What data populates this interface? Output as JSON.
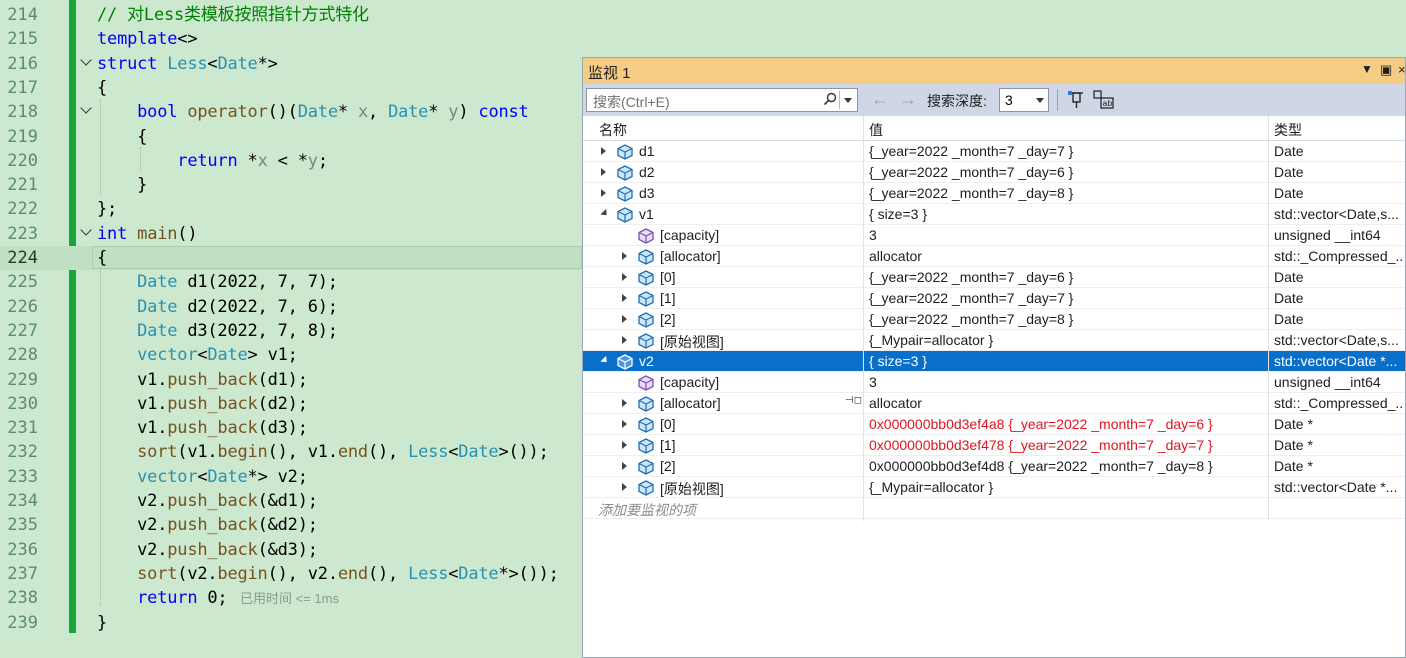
{
  "editor": {
    "lines": [
      {
        "n": "214",
        "html": "<span class=\"cm\">// 对Less类模板按照指针方式特化</span>"
      },
      {
        "n": "215",
        "html": "<span class=\"kw\">template</span>&lt;&gt;"
      },
      {
        "n": "216",
        "html": "<span class=\"kw\">struct</span> <span class=\"ty\">Less</span>&lt;<span class=\"ty\">Date</span>*&gt;"
      },
      {
        "n": "217",
        "html": "{"
      },
      {
        "n": "218",
        "html": "    <span class=\"kw\">bool</span> <span class=\"fn\">operator</span>()(<span class=\"ty\">Date</span>* <span class=\"pm\">x</span>, <span class=\"ty\">Date</span>* <span class=\"pm\">y</span>) <span class=\"kw\">const</span>"
      },
      {
        "n": "219",
        "html": "    {"
      },
      {
        "n": "220",
        "html": "        <span class=\"kw\">return</span> *<span class=\"pm\">x</span> &lt; *<span class=\"pm\">y</span>;"
      },
      {
        "n": "221",
        "html": "    }"
      },
      {
        "n": "222",
        "html": "};"
      },
      {
        "n": "223",
        "html": "<span class=\"kw\">int</span> <span class=\"fn\">main</span>()"
      },
      {
        "n": "224",
        "html": "{"
      },
      {
        "n": "225",
        "html": "    <span class=\"ty\">Date</span> d1(2022, 7, 7);"
      },
      {
        "n": "226",
        "html": "    <span class=\"ty\">Date</span> d2(2022, 7, 6);"
      },
      {
        "n": "227",
        "html": "    <span class=\"ty\">Date</span> d3(2022, 7, 8);"
      },
      {
        "n": "228",
        "html": "    <span class=\"ty\">vector</span>&lt;<span class=\"ty\">Date</span>&gt; v1;"
      },
      {
        "n": "229",
        "html": "    v1.<span class=\"fn\">push_back</span>(d1);"
      },
      {
        "n": "230",
        "html": "    v1.<span class=\"fn\">push_back</span>(d2);"
      },
      {
        "n": "231",
        "html": "    v1.<span class=\"fn\">push_back</span>(d3);"
      },
      {
        "n": "232",
        "html": "    <span class=\"fn\">sort</span>(v1.<span class=\"fn\">begin</span>(), v1.<span class=\"fn\">end</span>(), <span class=\"ty\">Less</span>&lt;<span class=\"ty\">Date</span>&gt;());"
      },
      {
        "n": "233",
        "html": "    <span class=\"ty\">vector</span>&lt;<span class=\"ty\">Date</span>*&gt; v2;"
      },
      {
        "n": "234",
        "html": "    v2.<span class=\"fn\">push_back</span>(&amp;d1);"
      },
      {
        "n": "235",
        "html": "    v2.<span class=\"fn\">push_back</span>(&amp;d2);"
      },
      {
        "n": "236",
        "html": "    v2.<span class=\"fn\">push_back</span>(&amp;d3);"
      },
      {
        "n": "237",
        "html": "    <span class=\"fn\">sort</span>(v2.<span class=\"fn\">begin</span>(), v2.<span class=\"fn\">end</span>(), <span class=\"ty\">Less</span>&lt;<span class=\"ty\">Date</span>*&gt;());"
      },
      {
        "n": "238",
        "html": "    <span class=\"kw\">return</span> 0;"
      },
      {
        "n": "239",
        "html": "}"
      }
    ],
    "current_line": "224",
    "perf_tip": "已用时间 <= 1ms"
  },
  "watch": {
    "title": "监视 1",
    "search_placeholder": "搜索(Ctrl+E)",
    "depth_label": "搜索深度:",
    "depth_value": "3",
    "columns": {
      "name": "名称",
      "value": "值",
      "type": "类型"
    },
    "rows": [
      {
        "name": "d1",
        "value": "{_year=2022 _month=7 _day=7 }",
        "type": "Date"
      },
      {
        "name": "d2",
        "value": "{_year=2022 _month=7 _day=6 }",
        "type": "Date"
      },
      {
        "name": "d3",
        "value": "{_year=2022 _month=7 _day=8 }",
        "type": "Date"
      },
      {
        "name": "v1",
        "value": "{ size=3 }",
        "type": "std::vector<Date,s..."
      },
      {
        "name": "[capacity]",
        "value": "3",
        "type": "unsigned __int64"
      },
      {
        "name": "[allocator]",
        "value": "allocator",
        "type": "std::_Compressed_..."
      },
      {
        "name": "[0]",
        "value": "{_year=2022 _month=7 _day=6 }",
        "type": "Date"
      },
      {
        "name": "[1]",
        "value": "{_year=2022 _month=7 _day=7 }",
        "type": "Date"
      },
      {
        "name": "[2]",
        "value": "{_year=2022 _month=7 _day=8 }",
        "type": "Date"
      },
      {
        "name": "[原始视图]",
        "value": "{_Mypair=allocator }",
        "type": "std::vector<Date,s..."
      },
      {
        "name": "v2",
        "value": "{ size=3 }",
        "type": "std::vector<Date *..."
      },
      {
        "name": "[capacity]",
        "value": "3",
        "type": "unsigned __int64"
      },
      {
        "name": "[allocator]",
        "value": "allocator",
        "type": "std::_Compressed_..."
      },
      {
        "name": "[0]",
        "value": "0x000000bb0d3ef4a8 {_year=2022 _month=7 _day=6 }",
        "type": "Date *"
      },
      {
        "name": "[1]",
        "value": "0x000000bb0d3ef478 {_year=2022 _month=7 _day=7 }",
        "type": "Date *"
      },
      {
        "name": "[2]",
        "value": "0x000000bb0d3ef4d8 {_year=2022 _month=7 _day=8 }",
        "type": "Date *"
      },
      {
        "name": "[原始视图]",
        "value": "{_Mypair=allocator }",
        "type": "std::vector<Date *..."
      }
    ],
    "add_placeholder": "添加要监视的项"
  }
}
